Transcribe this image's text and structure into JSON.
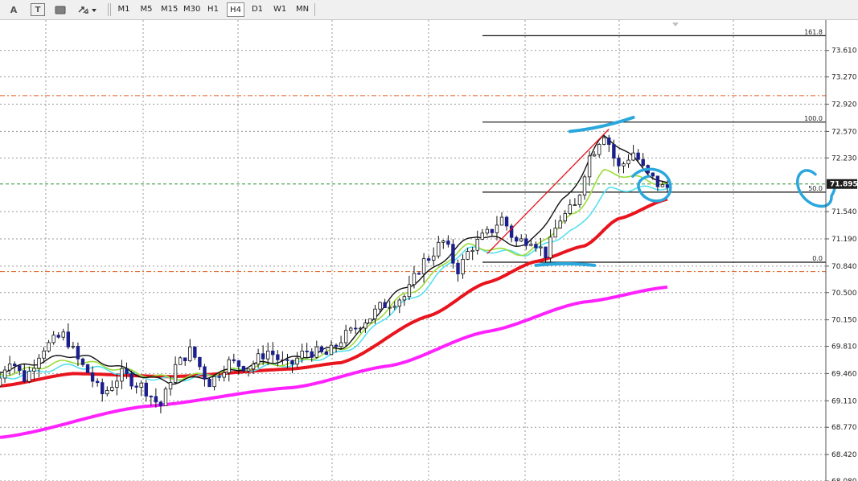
{
  "toolbar": {
    "text_tool": "A",
    "text_label_tool": "T",
    "timeframes": [
      "M1",
      "M5",
      "M15",
      "M30",
      "H1",
      "H4",
      "D1",
      "W1",
      "MN"
    ],
    "active_timeframe": "H4"
  },
  "chart_data": {
    "type": "candlestick",
    "y_axis": {
      "ticks": [
        "73.610",
        "73.270",
        "72.920",
        "72.570",
        "72.230",
        "71.540",
        "71.190",
        "70.840",
        "70.500",
        "70.150",
        "69.810",
        "69.460",
        "69.110",
        "68.770",
        "68.420",
        "68.080"
      ],
      "ylim": [
        68.08,
        74.0
      ]
    },
    "current_price": "71.895",
    "fibonacci": {
      "levels": [
        {
          "label": "161.8",
          "price": 73.8
        },
        {
          "label": "100.0",
          "price": 72.69
        },
        {
          "label": "50.0",
          "price": 71.79
        },
        {
          "label": "0.0",
          "price": 70.89
        }
      ],
      "anchor_low": {
        "bar": 108,
        "price": 70.89
      },
      "anchor_high": {
        "bar": 125,
        "price": 72.69
      }
    },
    "horizontal_lines": [
      {
        "price": 73.03,
        "style": "dash-dot",
        "color": "#e05a1a"
      },
      {
        "price": 70.77,
        "style": "dash-dot",
        "color": "#e05a1a"
      },
      {
        "price": 71.895,
        "style": "dashed",
        "color": "#2e8b2e"
      }
    ],
    "moving_averages": [
      {
        "color": "#ff22ff",
        "points": [
          [
            0,
            68.64
          ],
          [
            30,
            69.04
          ],
          [
            60,
            69.28
          ],
          [
            80,
            69.56
          ],
          [
            100,
            70.0
          ],
          [
            120,
            70.38
          ],
          [
            137,
            70.57
          ]
        ]
      },
      {
        "color": "#e8141e",
        "points": [
          [
            0,
            69.3
          ],
          [
            15,
            69.46
          ],
          [
            35,
            69.42
          ],
          [
            60,
            69.52
          ],
          [
            70,
            69.6
          ],
          [
            88,
            70.2
          ],
          [
            100,
            70.63
          ],
          [
            110,
            70.9
          ],
          [
            120,
            71.1
          ],
          [
            127,
            71.45
          ],
          [
            137,
            71.7
          ]
        ]
      },
      {
        "color": "#55e0f0",
        "points": [
          [
            0,
            69.4
          ],
          [
            15,
            69.56
          ],
          [
            35,
            69.38
          ],
          [
            60,
            69.58
          ],
          [
            70,
            69.72
          ],
          [
            84,
            70.4
          ],
          [
            96,
            71.06
          ],
          [
            108,
            71.0
          ],
          [
            118,
            71.3
          ],
          [
            125,
            71.82
          ],
          [
            137,
            71.85
          ]
        ]
      },
      {
        "color": "#9bdc39",
        "points": [
          [
            0,
            69.45
          ],
          [
            15,
            69.62
          ],
          [
            35,
            69.4
          ],
          [
            60,
            69.6
          ],
          [
            70,
            69.77
          ],
          [
            84,
            70.5
          ],
          [
            96,
            71.1
          ],
          [
            108,
            71.0
          ],
          [
            118,
            71.5
          ],
          [
            124,
            72.05
          ],
          [
            137,
            71.9
          ]
        ]
      },
      {
        "color": "#111111",
        "points": [
          [
            0,
            69.5
          ],
          [
            15,
            69.7
          ],
          [
            35,
            69.35
          ],
          [
            60,
            69.65
          ],
          [
            70,
            69.8
          ],
          [
            84,
            70.6
          ],
          [
            98,
            71.24
          ],
          [
            108,
            71.1
          ],
          [
            116,
            71.7
          ],
          [
            124,
            72.5
          ],
          [
            137,
            71.88
          ]
        ]
      }
    ],
    "price_path": [
      [
        0,
        69.3
      ],
      [
        3,
        69.65
      ],
      [
        6,
        69.4
      ],
      [
        10,
        69.8
      ],
      [
        14,
        69.95
      ],
      [
        18,
        69.55
      ],
      [
        22,
        69.2
      ],
      [
        26,
        69.45
      ],
      [
        30,
        69.3
      ],
      [
        34,
        69.05
      ],
      [
        37,
        69.55
      ],
      [
        40,
        69.75
      ],
      [
        44,
        69.35
      ],
      [
        48,
        69.6
      ],
      [
        52,
        69.55
      ],
      [
        56,
        69.75
      ],
      [
        60,
        69.55
      ],
      [
        64,
        69.75
      ],
      [
        68,
        69.7
      ],
      [
        72,
        69.95
      ],
      [
        76,
        70.15
      ],
      [
        80,
        70.35
      ],
      [
        84,
        70.45
      ],
      [
        88,
        70.9
      ],
      [
        92,
        71.15
      ],
      [
        95,
        70.8
      ],
      [
        98,
        71.1
      ],
      [
        101,
        71.25
      ],
      [
        104,
        71.45
      ],
      [
        107,
        71.15
      ],
      [
        110,
        71.2
      ],
      [
        113,
        71.0
      ],
      [
        116,
        71.45
      ],
      [
        119,
        71.6
      ],
      [
        122,
        72.25
      ],
      [
        125,
        72.55
      ],
      [
        128,
        72.1
      ],
      [
        131,
        72.3
      ],
      [
        134,
        72.0
      ],
      [
        137,
        71.85
      ]
    ],
    "bar_count": 138,
    "annotations": [
      {
        "kind": "trendline",
        "color": "#e8141e",
        "from": [
          100,
          71.0
        ],
        "to": [
          125,
          72.6
        ]
      },
      {
        "kind": "marker-line",
        "color": "#2aa7dc",
        "from": [
          117,
          72.57
        ],
        "to": [
          130,
          72.75
        ]
      },
      {
        "kind": "marker-line",
        "color": "#2aa7dc",
        "from": [
          110,
          70.85
        ],
        "to": [
          122,
          70.85
        ]
      },
      {
        "kind": "circle",
        "color": "#2aa7dc",
        "center": [
          134,
          71.87
        ]
      }
    ]
  }
}
